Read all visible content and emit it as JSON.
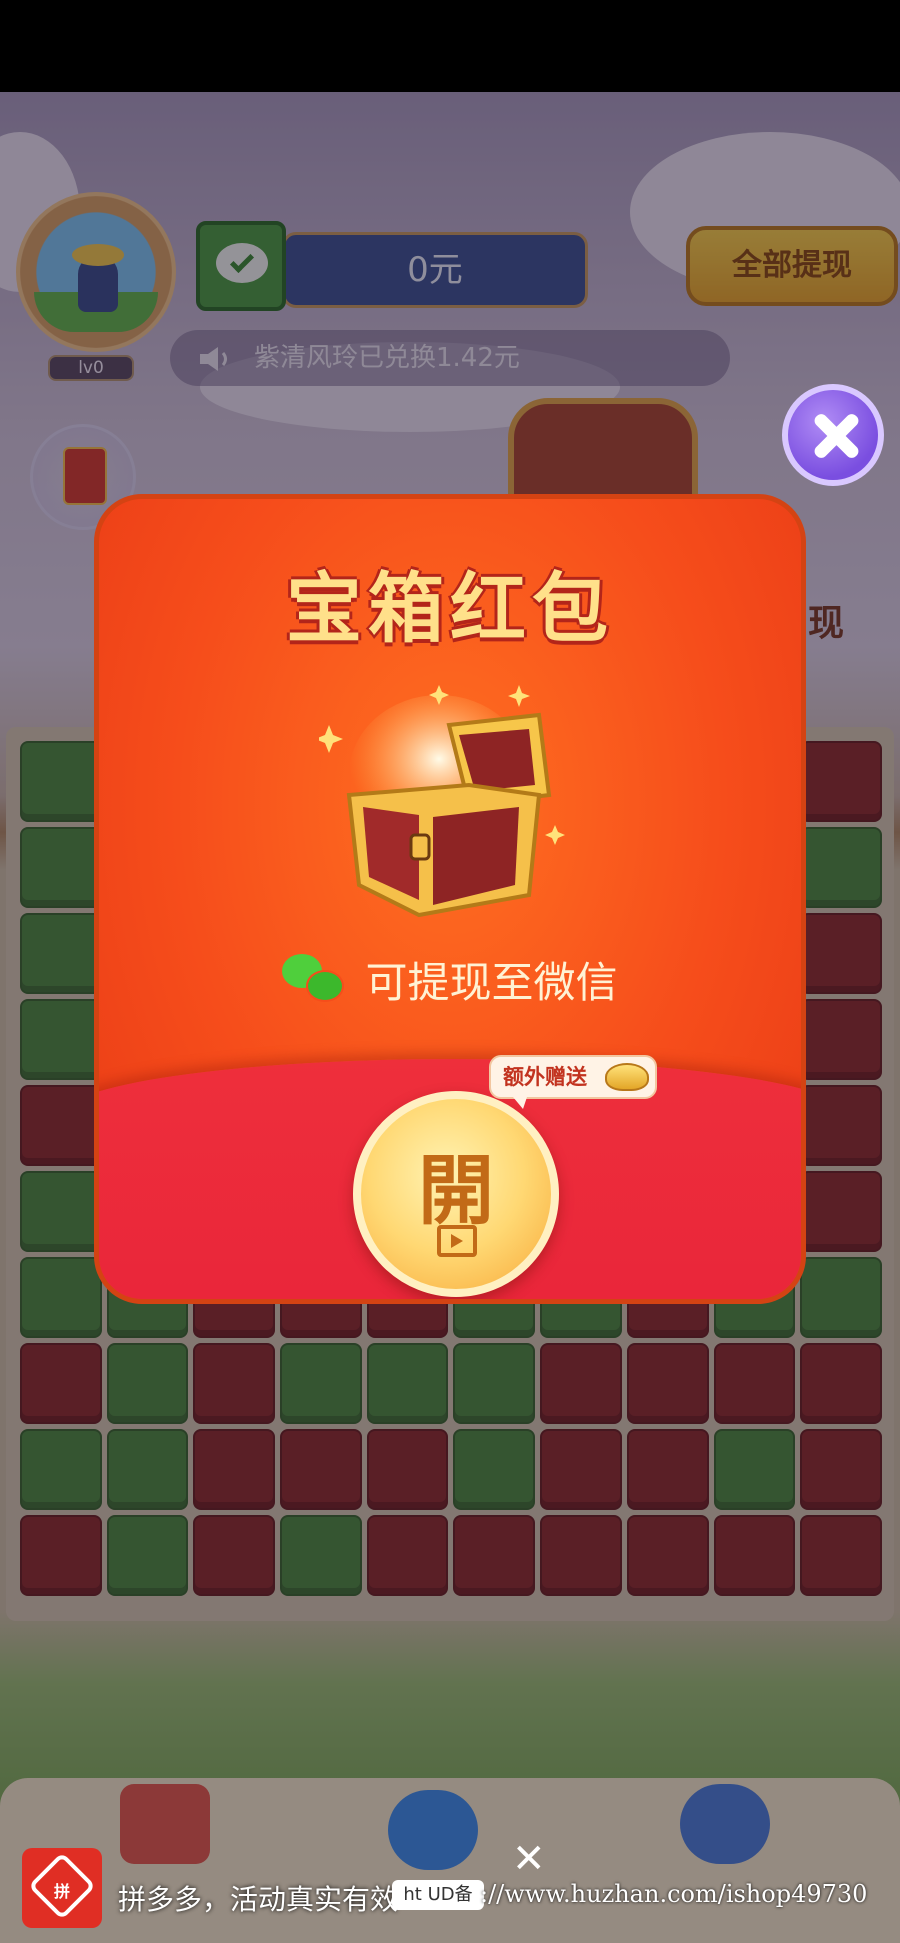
{
  "header": {
    "level": "lv0",
    "balance": "0元",
    "withdraw_all_label": "全部提现",
    "ticker_text": "紫清风玲已兑换1.42元"
  },
  "background": {
    "partial_label": "现"
  },
  "modal": {
    "title": "宝箱红包",
    "withdraw_note": "可提现至微信",
    "bonus_tag": "额外赠送",
    "open_button_char": "開"
  },
  "board": {
    "rows": [
      [
        "green",
        "red",
        "green",
        "green",
        "red",
        "red",
        "green",
        "red",
        "red",
        "red"
      ],
      [
        "green",
        "red",
        "red",
        "green",
        "green",
        "red",
        "red",
        "green",
        "red",
        "green"
      ],
      [
        "green",
        "red",
        "green",
        "red",
        "green",
        "green",
        "red",
        "red",
        "green",
        "red"
      ],
      [
        "green",
        "green",
        "red",
        "red",
        "red",
        "green",
        "green",
        "red",
        "red",
        "red"
      ],
      [
        "red",
        "red",
        "green",
        "red",
        "green",
        "red",
        "red",
        "green",
        "red",
        "red"
      ],
      [
        "green",
        "green",
        "red",
        "red",
        "green",
        "green",
        "red",
        "red",
        "green",
        "red"
      ],
      [
        "green",
        "green",
        "red",
        "red",
        "red",
        "green",
        "green",
        "red",
        "green",
        "green"
      ],
      [
        "red",
        "green",
        "red",
        "green",
        "green",
        "green",
        "red",
        "red",
        "red",
        "red"
      ],
      [
        "green",
        "green",
        "red",
        "red",
        "red",
        "green",
        "red",
        "red",
        "green",
        "red"
      ],
      [
        "red",
        "green",
        "red",
        "green",
        "red",
        "red",
        "red",
        "red",
        "red",
        "red"
      ]
    ]
  },
  "ad": {
    "text": "拼多多，活动真实有效",
    "logo_label": "拼",
    "chip_text": "ht UD备",
    "watermark": "://www.huzhan.com/ishop49730"
  },
  "colors": {
    "modal_orange": "#f64d1b",
    "modal_red": "#e8233a",
    "title_gold": "#ffe08a",
    "close_purple": "#7a4ee0",
    "withdraw_yellow": "#f8cf4a"
  }
}
